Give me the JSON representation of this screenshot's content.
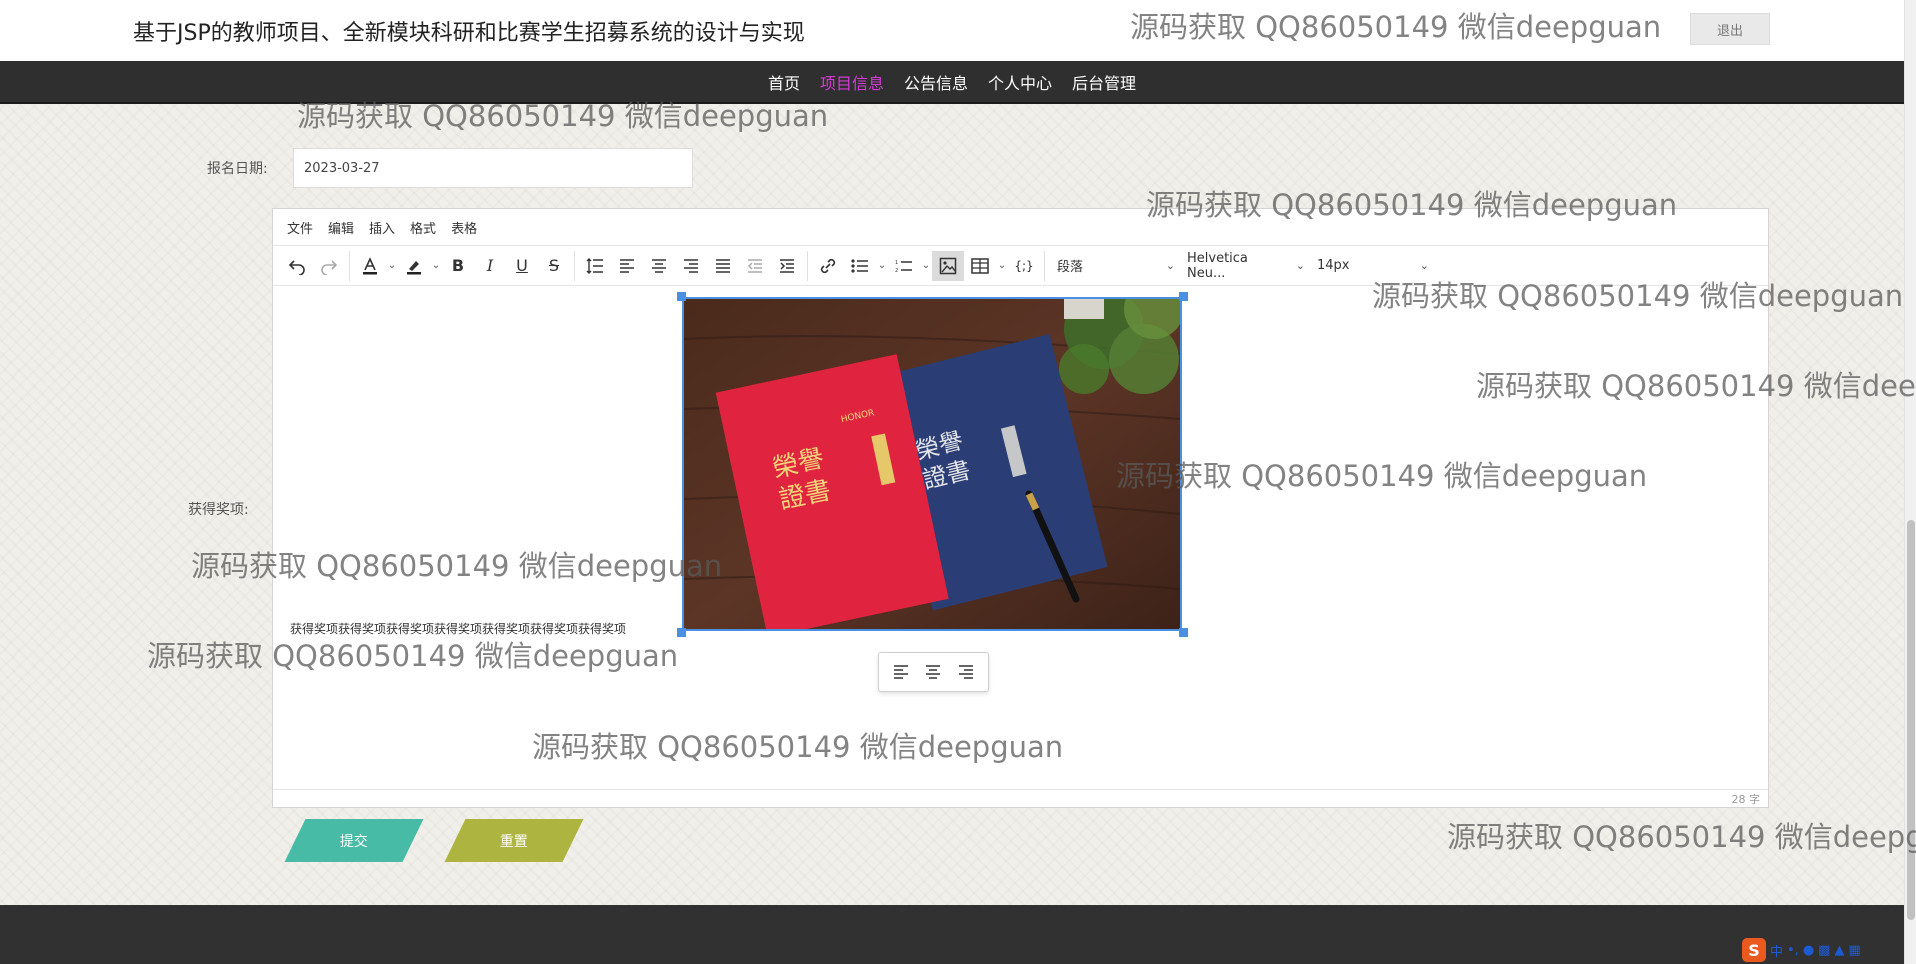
{
  "header": {
    "title": "基于JSP的教师项目、全新模块科研和比赛学生招募系统的设计与实现",
    "logout_label": "退出"
  },
  "nav": {
    "items": [
      {
        "label": "首页",
        "active": false
      },
      {
        "label": "项目信息",
        "active": true
      },
      {
        "label": "公告信息",
        "active": false
      },
      {
        "label": "个人中心",
        "active": false
      },
      {
        "label": "后台管理",
        "active": false
      }
    ],
    "active_color": "#d63bd6"
  },
  "form": {
    "signup_date_label": "报名日期:",
    "signup_date_value": "2023-03-27",
    "award_label": "获得奖项:"
  },
  "editor": {
    "menu": [
      "文件",
      "编辑",
      "插入",
      "格式",
      "表格"
    ],
    "toolbar_icons": [
      "undo-icon",
      "redo-icon",
      "text-color-icon",
      "highlight-color-icon",
      "bold-icon",
      "italic-icon",
      "underline-icon",
      "strikethrough-icon",
      "line-height-icon",
      "align-left-icon",
      "align-center-icon",
      "align-right-icon",
      "align-justify-icon",
      "outdent-icon",
      "indent-icon",
      "link-icon",
      "bullet-list-icon",
      "numbered-list-icon",
      "image-icon",
      "table-icon",
      "code-icon"
    ],
    "block_format": "段落",
    "font_family": "Helvetica Neu...",
    "font_size": "14px",
    "body_text": "获得奖项获得奖项获得奖项获得奖项获得奖项获得奖项获得奖项",
    "word_count": "28 字",
    "image_align_icons": [
      "align-left-icon",
      "align-center-icon",
      "align-right-icon"
    ],
    "image_cover_text": [
      "榮譽",
      "證書"
    ],
    "image_cover_subtext": "HONOR"
  },
  "buttons": {
    "submit_label": "提交",
    "reset_label": "重置",
    "submit_color": "#47bba5",
    "reset_color": "#adb43f"
  },
  "watermark_text": "源码获取 QQ86050149 微信deepguan",
  "tray": {
    "ime_logo": "S",
    "ime_lang": "中"
  }
}
